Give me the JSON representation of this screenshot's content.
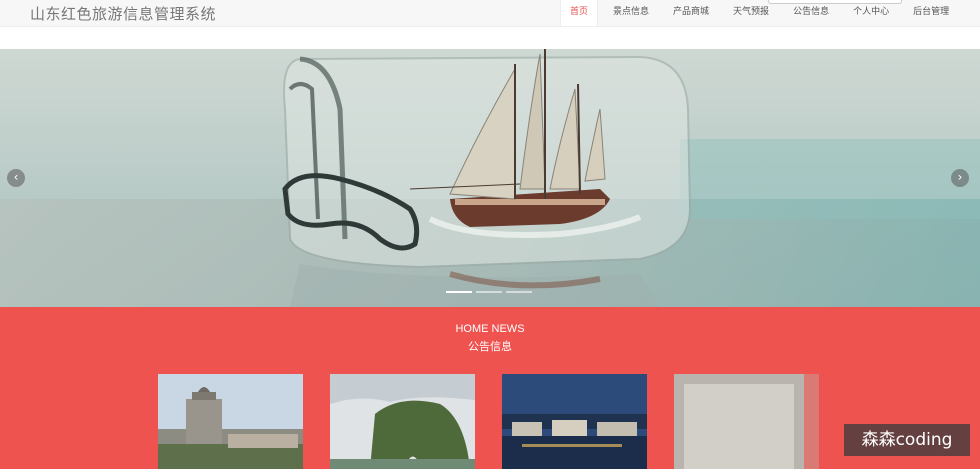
{
  "header": {
    "site_title": "山东红色旅游信息管理系统",
    "nav": [
      {
        "label": "首页",
        "active": true
      },
      {
        "label": "景点信息",
        "active": false
      },
      {
        "label": "产品商城",
        "active": false
      },
      {
        "label": "天气预报",
        "active": false
      },
      {
        "label": "公告信息",
        "active": false
      },
      {
        "label": "个人中心",
        "active": false
      },
      {
        "label": "后台管理",
        "active": false
      }
    ]
  },
  "carousel": {
    "prev_icon": "‹",
    "next_icon": "›",
    "slide_count": 3,
    "active_index": 0
  },
  "news": {
    "title_en": "HOME NEWS",
    "title_zh": "公告信息",
    "background": "#ef5350"
  },
  "watermark": "森森coding",
  "colors": {
    "accent": "#e55353",
    "section_bg": "#ef5350"
  }
}
